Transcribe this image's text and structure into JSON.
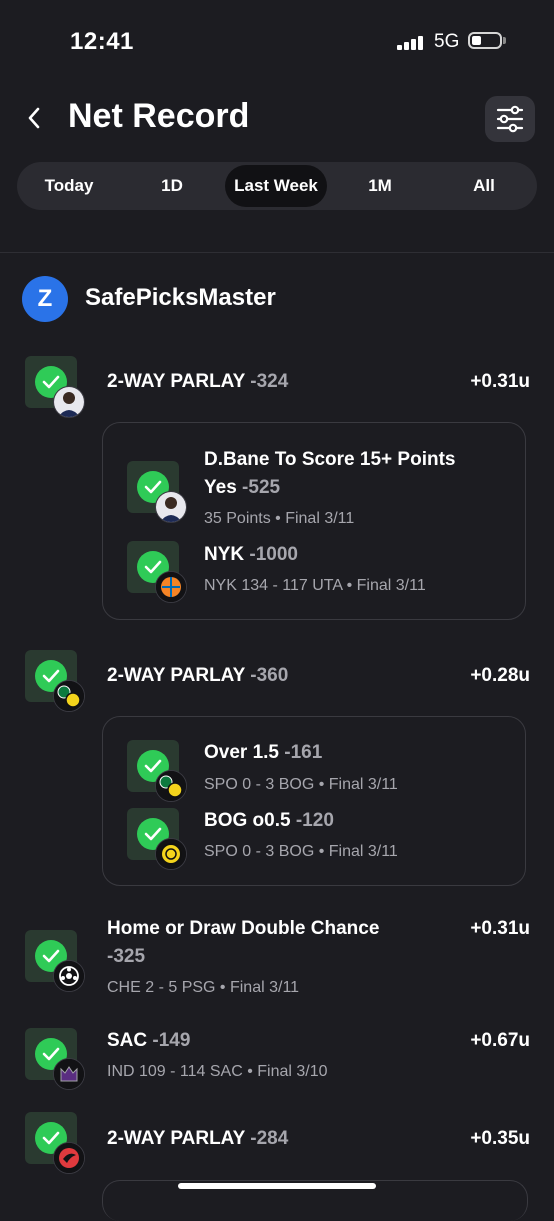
{
  "status_bar": {
    "time": "12:41",
    "network": "5G"
  },
  "header": {
    "title": "Net Record"
  },
  "tabs": [
    {
      "label": "Today",
      "active": false
    },
    {
      "label": "1D",
      "active": false
    },
    {
      "label": "Last Week",
      "active": true
    },
    {
      "label": "1M",
      "active": false
    },
    {
      "label": "All",
      "active": false
    }
  ],
  "user": {
    "initial": "Z",
    "name": "SafePicksMaster"
  },
  "picks": [
    {
      "title": "2-WAY PARLAY",
      "odds": "-324",
      "units": "+0.31u",
      "icon": "player-headshot-icon",
      "legs": [
        {
          "title_line1": "D.Bane To Score 15+ Points",
          "title_line2": "Yes",
          "odds": "-525",
          "detail": "35 Points • Final 3/11",
          "icon": "player-headshot-icon"
        },
        {
          "title_line1": "NYK",
          "odds": "-1000",
          "detail": "NYK 134 - 117 UTA • Final 3/11",
          "icon": "knicks-logo-icon"
        }
      ]
    },
    {
      "title": "2-WAY PARLAY",
      "odds": "-360",
      "units": "+0.28u",
      "icon": "soccer-crests-icon",
      "legs": [
        {
          "title_line1": "Over 1.5",
          "odds": "-161",
          "detail": "SPO 0 - 3 BOG • Final 3/11",
          "icon": "soccer-crests-icon"
        },
        {
          "title_line1": "BOG o0.5",
          "odds": "-120",
          "detail": "SPO 0 - 3 BOG • Final 3/11",
          "icon": "bodo-glimt-crest-icon"
        }
      ]
    },
    {
      "title_line1": "Home or Draw Double Chance",
      "odds": "-325",
      "units": "+0.31u",
      "detail": "CHE 2 - 5 PSG • Final 3/11",
      "icon": "soccer-ball-icon"
    },
    {
      "title": "SAC",
      "odds": "-149",
      "units": "+0.67u",
      "detail": "IND 109 - 114 SAC • Final 3/10",
      "icon": "kings-logo-icon"
    },
    {
      "title": "2-WAY PARLAY",
      "odds": "-284",
      "units": "+0.35u",
      "icon": "hawks-logo-icon"
    }
  ],
  "colors": {
    "background": "#1c1c21",
    "check_green": "#2fcb57",
    "muted_text": "#a6a6ad",
    "avatar_blue": "#2a73e8"
  }
}
